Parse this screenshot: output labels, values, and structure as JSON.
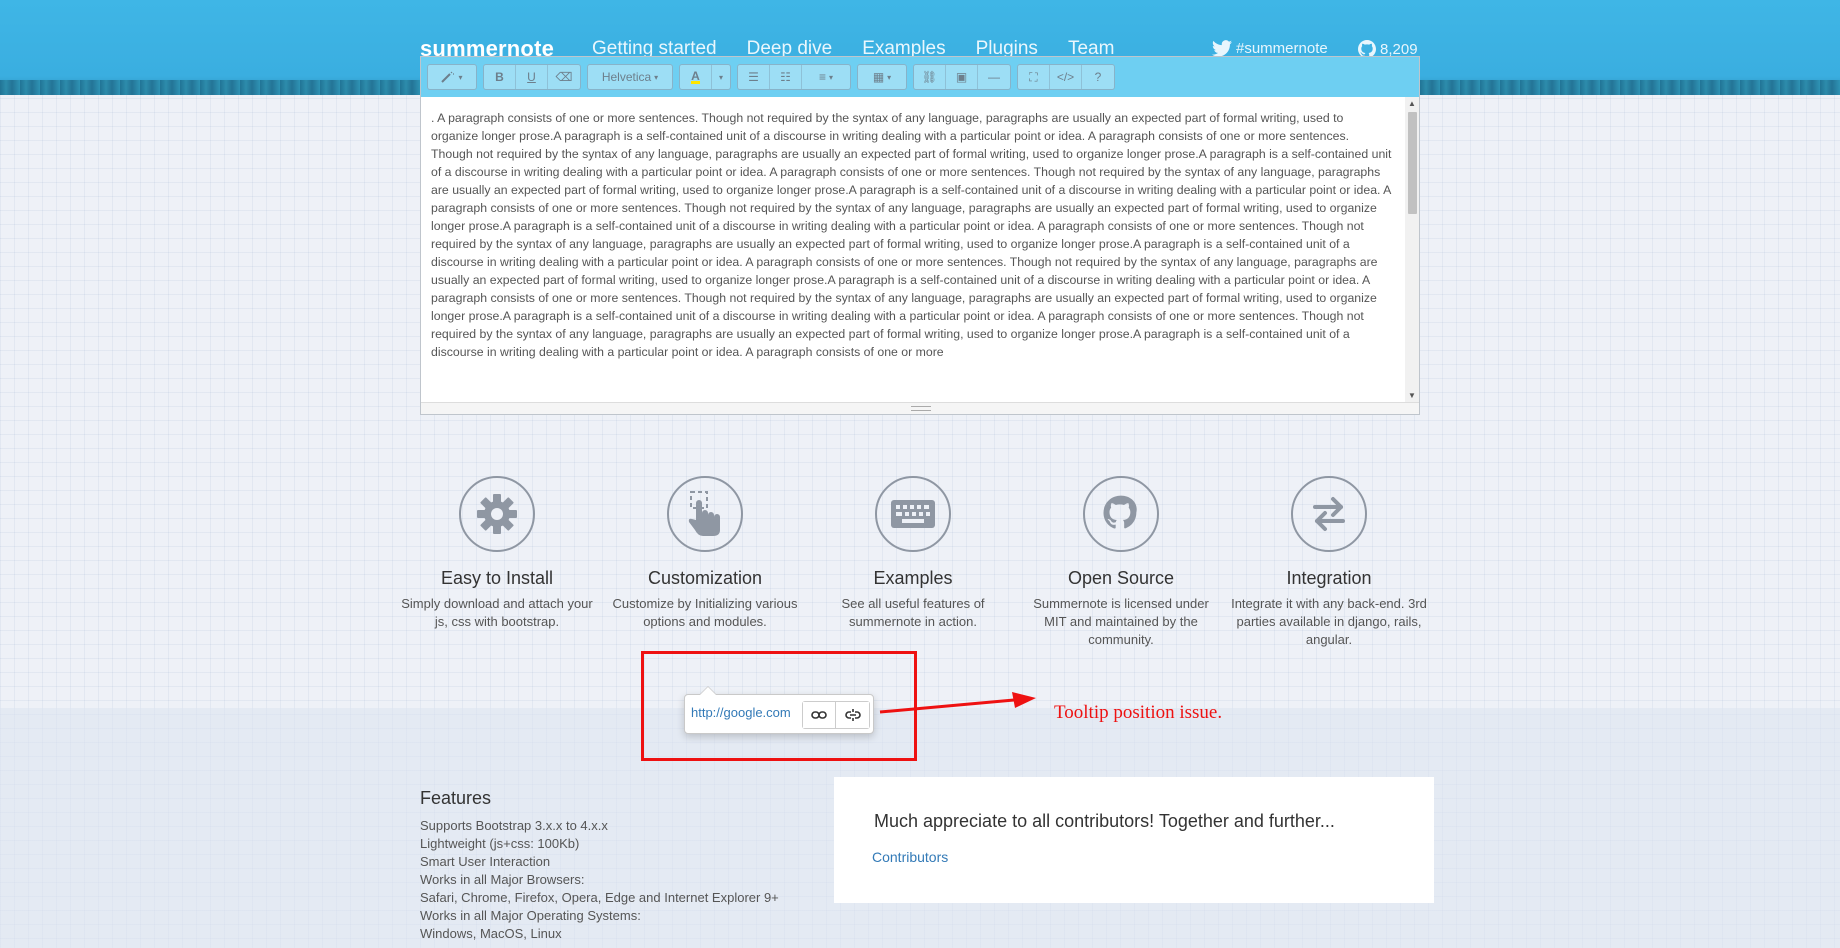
{
  "header": {
    "logo": "summernote",
    "nav": [
      "Getting started",
      "Deep dive",
      "Examples",
      "Plugins",
      "Team"
    ],
    "twitter": "#summernote",
    "github_stars": "8,209"
  },
  "editor": {
    "toolbar": {
      "font_name": "Helvetica"
    },
    "content": ". A paragraph consists of one or more sentences. Though not required by the syntax of any language, paragraphs are usually an expected part of formal writing, used to organize longer prose.A paragraph is a self-contained unit of a discourse in writing dealing with a particular point or idea. A paragraph consists of one or more sentences. Though not required by the syntax of any language, paragraphs are usually an expected part of formal writing, used to organize longer prose.A paragraph is a self-contained unit of a discourse in writing dealing with a particular point or idea. A paragraph consists of one or more sentences. Though not required by the syntax of any language, paragraphs are usually an expected part of formal writing, used to organize longer prose.A paragraph is a self-contained unit of a discourse in writing dealing with a particular point or idea. A paragraph consists of one or more sentences. Though not required by the syntax of any language, paragraphs are usually an expected part of formal writing, used to organize longer prose.A paragraph is a self-contained unit of a discourse in writing dealing with a particular point or idea. A paragraph consists of one or more sentences. Though not required by the syntax of any language, paragraphs are usually an expected part of formal writing, used to organize longer prose.A paragraph is a self-contained unit of a discourse in writing dealing with a particular point or idea. A paragraph consists of one or more sentences. Though not required by the syntax of any language, paragraphs are usually an expected part of formal writing, used to organize longer prose.A paragraph is a self-contained unit of a discourse in writing dealing with a particular point or idea. A paragraph consists of one or more sentences. Though not required by the syntax of any language, paragraphs are usually an expected part of formal writing, used to organize longer prose.A paragraph is a self-contained unit of a discourse in writing dealing with a particular point or idea. A paragraph consists of one or more sentences. Though not required by the syntax of any language, paragraphs are usually an expected part of formal writing, used to organize longer prose.A paragraph is a self-contained unit of a discourse in writing dealing with a particular point or idea. A paragraph consists of one or more"
  },
  "features": [
    {
      "icon": "gear-icon",
      "title": "Easy to Install",
      "desc": "Simply download and attach your js, css with bootstrap."
    },
    {
      "icon": "touch-hand-icon",
      "title": "Customization",
      "desc": "Customize by Initializing various options and modules."
    },
    {
      "icon": "keyboard-icon",
      "title": "Examples",
      "desc": "See all useful features of summernote in action."
    },
    {
      "icon": "github-icon",
      "title": "Open Source",
      "desc": "Summernote is licensed under MIT and maintained by the community."
    },
    {
      "icon": "exchange-icon",
      "title": "Integration",
      "desc": "Integrate it with any back-end. 3rd parties available in django, rails, angular."
    }
  ],
  "tooltip": {
    "link": "http://google.com"
  },
  "annotation": {
    "text": "Tooltip position issue.",
    "color": "#ee1111"
  },
  "features_list": {
    "title": "Features",
    "items": [
      "Supports Bootstrap 3.x.x to 4.x.x",
      "Lightweight (js+css: 100Kb)",
      "Smart User Interaction",
      "Works in all Major Browsers:",
      "Safari, Chrome, Firefox, Opera, Edge and Internet Explorer 9+",
      "Works in all Major Operating Systems:",
      "Windows, MacOS, Linux"
    ]
  },
  "contributors": {
    "heading": "Much appreciate to all contributors! Together and further...",
    "link": "Contributors"
  },
  "colors": {
    "header": "#3fb6e6",
    "link": "#337ab7"
  }
}
